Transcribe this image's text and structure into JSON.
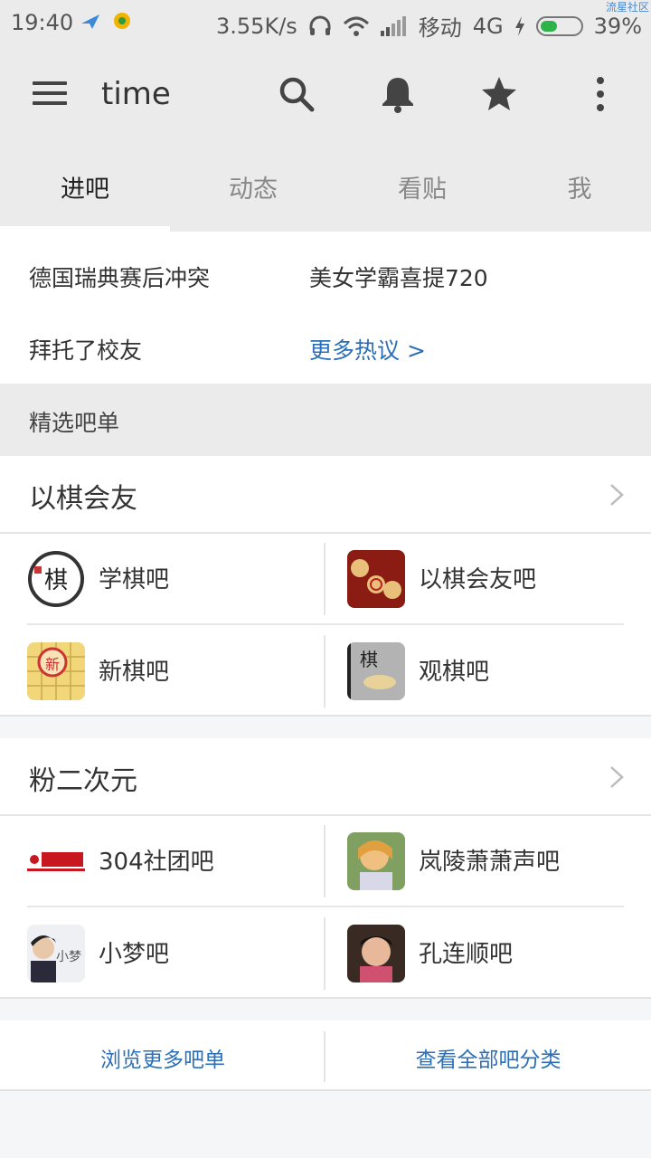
{
  "status_bar": {
    "time": "19:40",
    "speed": "3.55K/s",
    "carrier": "移动",
    "network": "4G",
    "battery": "39%",
    "watermark": "流星社区"
  },
  "app_bar": {
    "title": "time",
    "icons": [
      "menu-icon",
      "search-icon",
      "bell-icon",
      "star-icon",
      "more-vert-icon"
    ]
  },
  "tabs": [
    {
      "label": "进吧",
      "active": true
    },
    {
      "label": "动态",
      "active": false
    },
    {
      "label": "看贴",
      "active": false
    },
    {
      "label": "我",
      "active": false
    }
  ],
  "hot_topics": [
    {
      "label": "德国瑞典赛后冲突"
    },
    {
      "label": "美女学霸喜提720"
    },
    {
      "label": "拜托了校友"
    },
    {
      "label": "更多热议 >"
    }
  ],
  "section_title": "精选吧单",
  "cards": [
    {
      "title": "以棋会友",
      "items": [
        {
          "label": "学棋吧"
        },
        {
          "label": "以棋会友吧"
        },
        {
          "label": "新棋吧"
        },
        {
          "label": "观棋吧"
        }
      ]
    },
    {
      "title": "粉二次元",
      "items": [
        {
          "label": "304社团吧"
        },
        {
          "label": "岚陵萧萧声吧"
        },
        {
          "label": "小梦吧"
        },
        {
          "label": "孔连顺吧"
        }
      ]
    }
  ],
  "footer": {
    "browse_more": "浏览更多吧单",
    "all_categories": "查看全部吧分类"
  },
  "colors": {
    "link": "#2c6fb6",
    "background": "#ebebeb",
    "battery": "#2fb24a"
  }
}
